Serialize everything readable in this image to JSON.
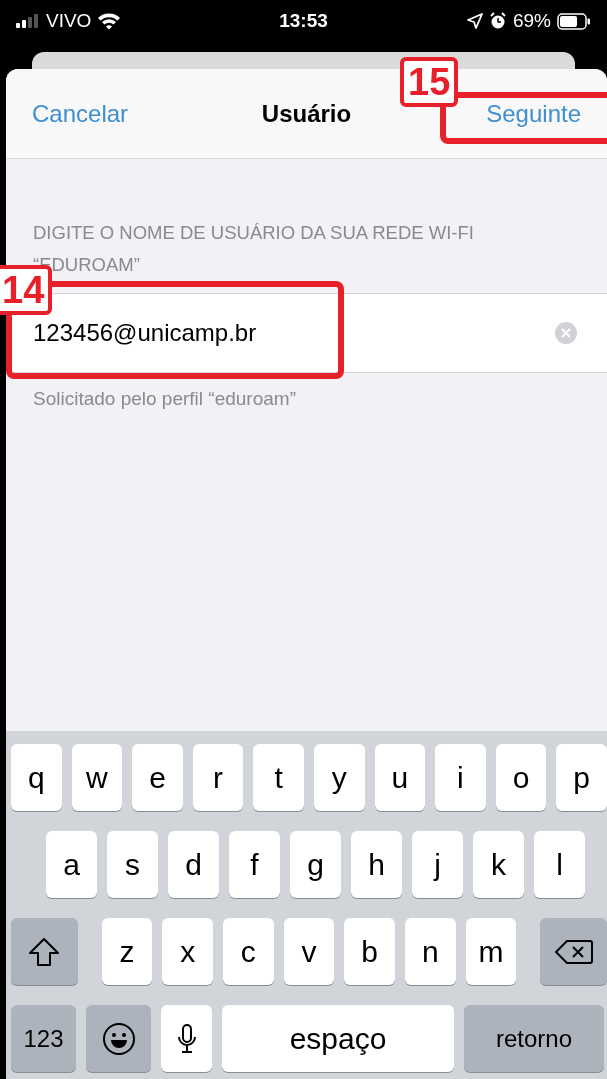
{
  "status_bar": {
    "carrier": "VIVO",
    "time": "13:53",
    "battery": "69%"
  },
  "nav": {
    "cancel": "Cancelar",
    "title": "Usuário",
    "next": "Seguinte"
  },
  "section_header": "DIGITE O NOME DE USUÁRIO DA SUA REDE WI-FI “EDUROAM”",
  "username_field": {
    "value": "123456@unicamp.br"
  },
  "section_footer": "Solicitado pelo perfil “eduroam”",
  "keyboard": {
    "rows": [
      [
        "q",
        "w",
        "e",
        "r",
        "t",
        "y",
        "u",
        "i",
        "o",
        "p"
      ],
      [
        "a",
        "s",
        "d",
        "f",
        "g",
        "h",
        "j",
        "k",
        "l"
      ],
      [
        "z",
        "x",
        "c",
        "v",
        "b",
        "n",
        "m"
      ]
    ],
    "numbers_key": "123",
    "space_key": "espaço",
    "return_key": "retorno"
  },
  "annotations": [
    {
      "label": "15"
    },
    {
      "label": "14"
    }
  ]
}
